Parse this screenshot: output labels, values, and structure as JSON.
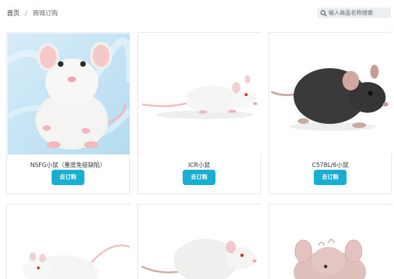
{
  "breadcrumb": {
    "home": "首页",
    "separator": "/",
    "current": "商城订购"
  },
  "search": {
    "placeholder": "输入商品名称搜索",
    "icon": "search-icon"
  },
  "colors": {
    "accent": "#1aaed3",
    "search_bg": "#eceff2",
    "card_border": "#e6e6e6"
  },
  "products": [
    {
      "name": "NSFG小鼠（重度免疫缺陷）",
      "button": "去订购"
    },
    {
      "name": "ICR小鼠",
      "button": "去订购"
    },
    {
      "name": "C57BL/6小鼠",
      "button": "去订购"
    },
    {
      "name": "",
      "button": ""
    },
    {
      "name": "",
      "button": ""
    },
    {
      "name": "",
      "button": ""
    }
  ]
}
